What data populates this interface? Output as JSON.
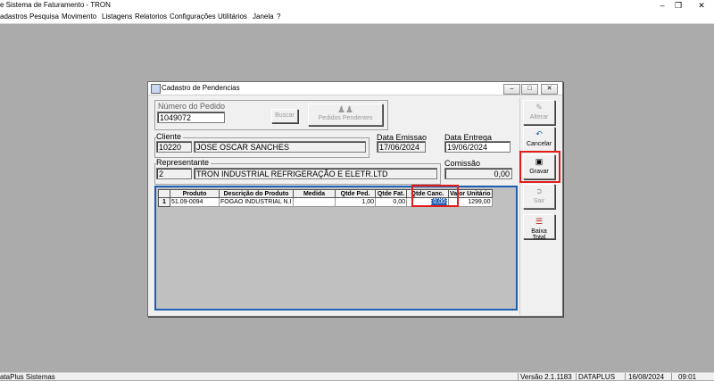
{
  "window": {
    "title": "e Sistema de Faturamento - TRON",
    "menu": [
      "adastros",
      "Pesquisa",
      "Movimento",
      "Listagens",
      "Relatorios",
      "Configurações",
      "Utilitários",
      "Janela",
      "?"
    ]
  },
  "status": {
    "left": "ataPlus Sistemas",
    "version": "Versão 2.1.1183",
    "company": "DATAPLUS",
    "date": "16/08/2024",
    "time": "09:01"
  },
  "dialog": {
    "title": "Cadastro de Pendencias",
    "numero_pedido_label": "Número do Pedido",
    "numero_pedido": "1049072",
    "buscar_label": "Buscar",
    "pedidos_pendentes_label": "Pedidos Pendentes",
    "cliente_label": "Cliente",
    "cliente_codigo": "10220",
    "cliente_nome": "JOSE OSCAR SANCHES",
    "data_emissao_label": "Data Emissao",
    "data_emissao": "17/06/2024",
    "data_entrega_label": "Data Entrega",
    "data_entrega": "19/06/2024",
    "representante_label": "Representante",
    "representante_codigo": "2",
    "representante_nome": "TRON INDUSTRIAL REFRIGERAÇÃO E ELETR.LTD",
    "comissao_label": "Comissão",
    "comissao": "0,00"
  },
  "sidebar": {
    "alterar": "Alterar",
    "cancelar": "Cancelar",
    "gravar": "Gravar",
    "sair": "Sair",
    "baixa_total": "Baixa Total"
  },
  "grid": {
    "headers": [
      "Produto",
      "Descrição do Produto",
      "Medida",
      "Qtde Ped.",
      "Qtde Fat.",
      "Qtde Canc.",
      "Valor Unitário"
    ],
    "rows": [
      {
        "idx": "1",
        "produto": "51.09-0094",
        "descricao": "FOGAO INDUSTRIAL N.I",
        "medida": "",
        "qtde_ped": "1,00",
        "qtde_fat": "0,00",
        "qtde_canc": "0,00",
        "valor_unitario": "1299,00"
      }
    ]
  },
  "colors": {
    "accent": "#1e5fb4",
    "highlight": "#e01d1d"
  }
}
